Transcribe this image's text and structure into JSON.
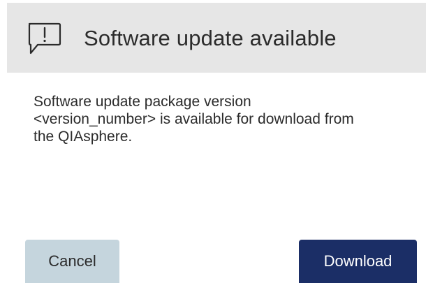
{
  "dialog": {
    "title": "Software update available",
    "icon": "speech-bubble-exclamation-icon",
    "message_lines": [
      "Software update package version",
      "<version_number> is available for download from",
      "the QIAsphere."
    ],
    "cancel_label": "Cancel",
    "download_label": "Download"
  },
  "colors": {
    "header_bg": "#e6e6e6",
    "cancel_bg": "#c5d5dd",
    "download_bg": "#1b2e66",
    "download_text": "#ffffff",
    "text": "#2b2b2b"
  }
}
